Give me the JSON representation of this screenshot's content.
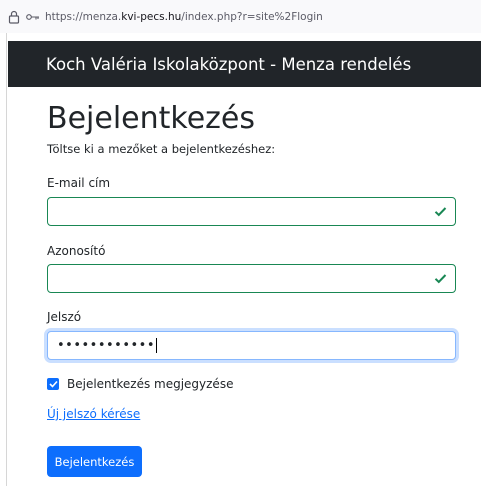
{
  "browser": {
    "url_prefix": "https://menza.",
    "url_host": "kvi-pecs.hu",
    "url_suffix": "/index.php?r=site%2Flogin",
    "lock_icon": "lock-icon",
    "key_icon": "key-icon"
  },
  "navbar": {
    "brand": "Koch Valéria Iskolaközpont - Menza rendelés",
    "background": "#212529"
  },
  "form": {
    "title": "Bejelentkezés",
    "subtitle": "Töltse ki a mezőket a bejelentkezéshez:",
    "email_label": "E-mail cím",
    "email_value": "",
    "id_label": "Azonosító",
    "id_value": "",
    "password_label": "Jelszó",
    "password_value": "••••••••••••",
    "remember_label": "Bejelentkezés megjegyzése",
    "remember_checked": true,
    "reset_link": "Új jelszó kérése",
    "submit_label": "Bejelentkezés"
  },
  "colors": {
    "valid": "#198754",
    "primary": "#0d6efd",
    "focus": "#86b7fe"
  }
}
